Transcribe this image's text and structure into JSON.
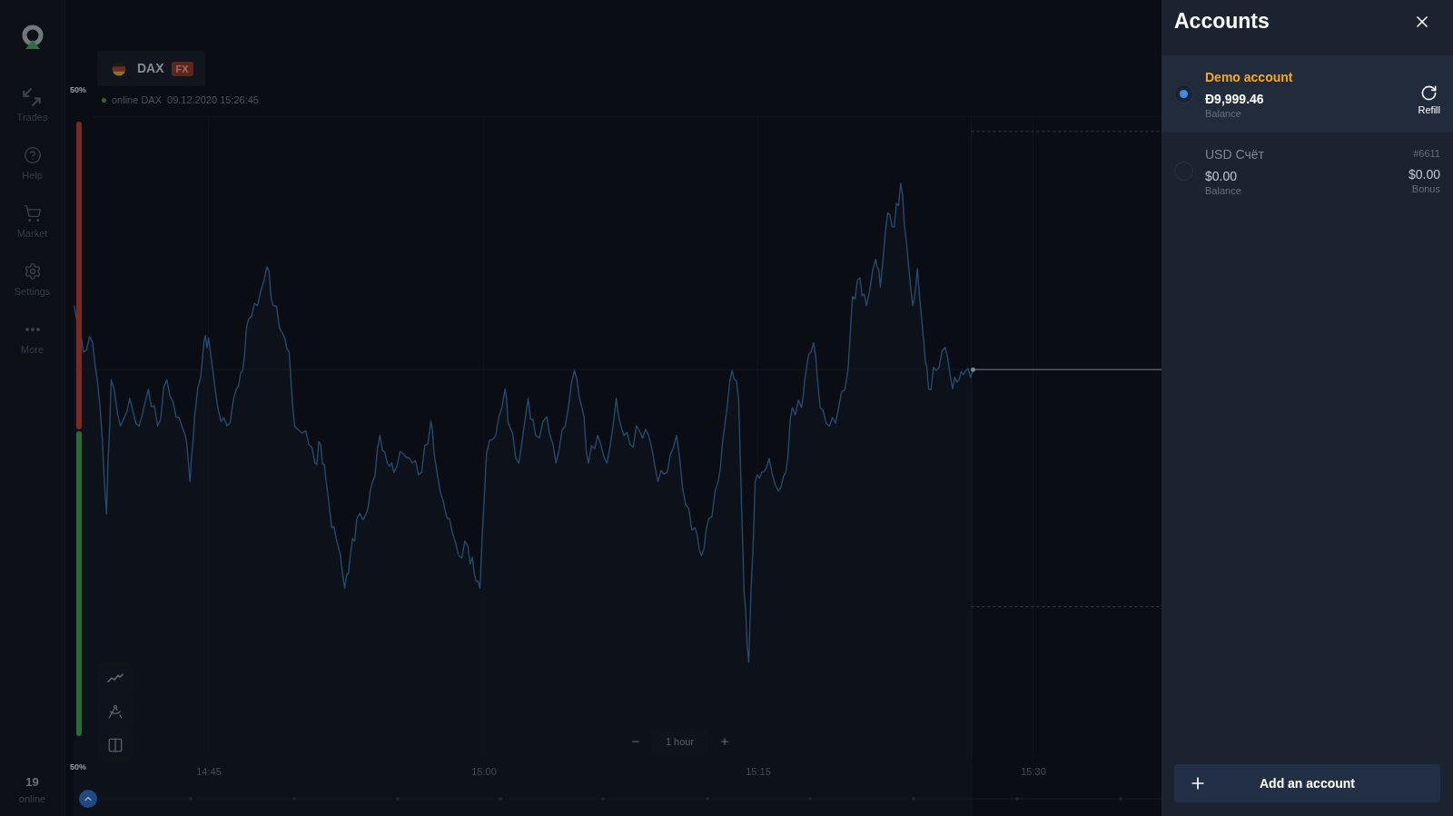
{
  "sidebar": {
    "items": [
      {
        "label": "Trades"
      },
      {
        "label": "Help"
      },
      {
        "label": "Market"
      },
      {
        "label": "Settings"
      },
      {
        "label": "More"
      }
    ],
    "online_count": "19",
    "online_label": "online"
  },
  "instrument": {
    "name": "DAX",
    "market": "FX",
    "status": "online DAX",
    "timestamp": "09.12.2020 15:26:45"
  },
  "sentiment": {
    "top_label": "50%",
    "bottom_label": "50%",
    "level": 0.5
  },
  "chart": {
    "time_labels": [
      "14:45",
      "15:00",
      "15:15",
      "15:30"
    ]
  },
  "timeframe": {
    "label": "1 hour"
  },
  "accounts_panel": {
    "title": "Accounts",
    "accounts": [
      {
        "kind": "demo",
        "selected": true,
        "name": "Demo account",
        "amount": "Đ9,999.46",
        "amount_label": "Balance",
        "action": "Refill"
      },
      {
        "kind": "real",
        "selected": false,
        "name": "USD Счёт",
        "number": "#6611",
        "amount": "$0.00",
        "amount_label": "Balance",
        "bonus": "$0.00",
        "bonus_label": "Bonus"
      }
    ],
    "add_button": "Add an account"
  }
}
